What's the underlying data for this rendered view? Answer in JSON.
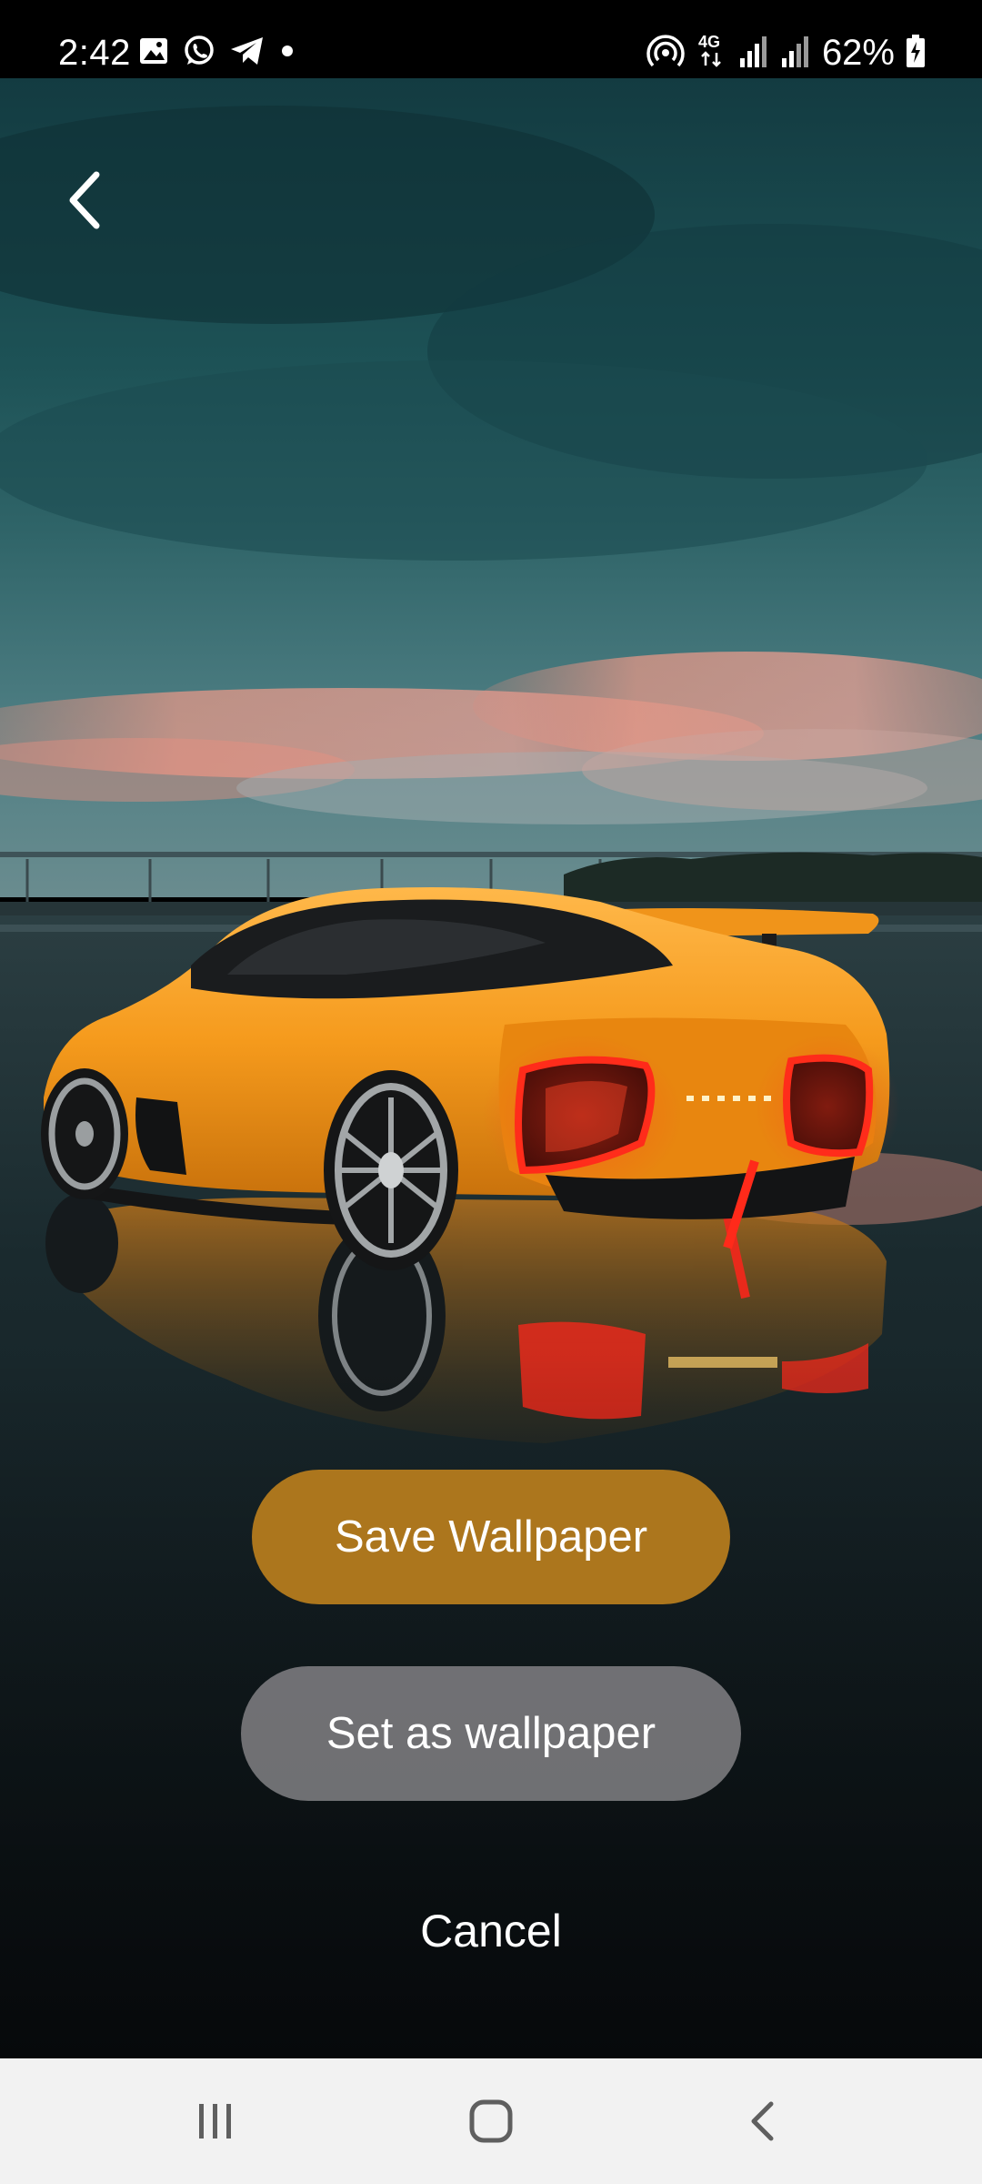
{
  "status_bar": {
    "time": "2:42",
    "battery_percent": "62%",
    "network_label": "4G",
    "icons": [
      "gallery-icon",
      "whatsapp-icon",
      "telegram-icon",
      "dot-icon",
      "hotspot-icon",
      "network-4g-icon",
      "signal-icon",
      "signal-icon-2",
      "battery-charging-icon"
    ]
  },
  "actions": {
    "save_label": "Save Wallpaper",
    "set_label": "Set as wallpaper",
    "cancel_label": "Cancel"
  },
  "colors": {
    "save_button": "#ba7e1d",
    "set_button": "#78787c",
    "nav_background": "#f2f2f2",
    "car_body": "#f5a623",
    "tail_light": "#ff2a1a"
  },
  "navigation": {
    "buttons": [
      "recent-apps-icon",
      "home-icon",
      "back-icon"
    ]
  }
}
